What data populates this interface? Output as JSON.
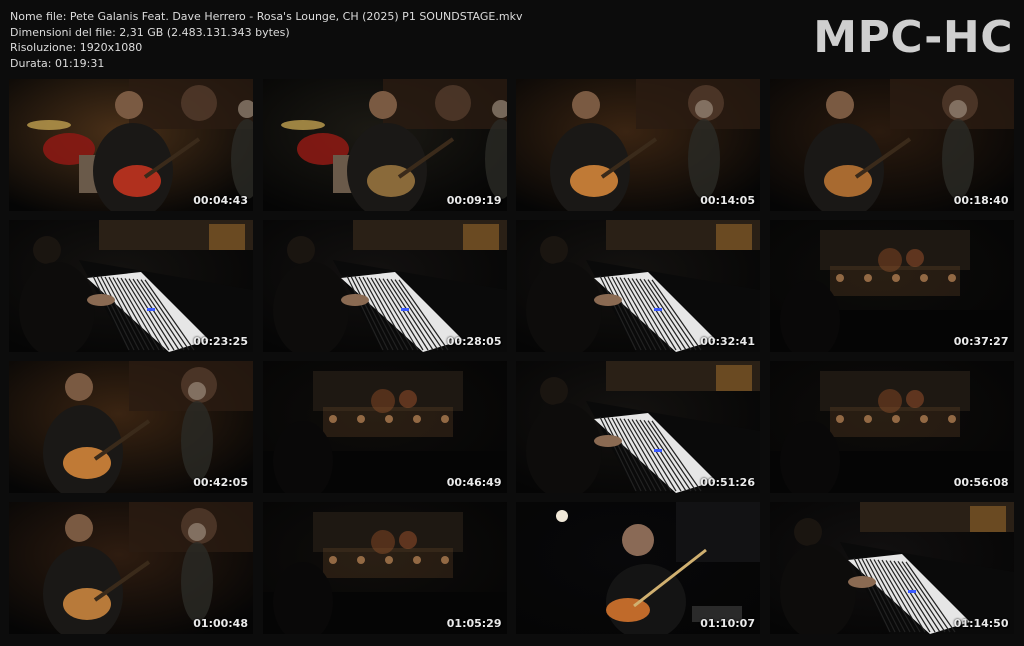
{
  "info": {
    "file_name": "Nome file: Pete Galanis Feat. Dave Herrero - Rosa's Lounge, CH (2025) P1 SOUNDSTAGE.mkv",
    "file_size": "Dimensioni del file: 2,31 GB (2.483.131.343 bytes)",
    "resolution": "Risoluzione: 1920x1080",
    "duration": "Durata: 01:19:31"
  },
  "logo": "MPC-HC",
  "thumbnails": [
    {
      "time": "00:04:43",
      "scene": "band-stage",
      "bg": "#4a3018",
      "accent": "#b0301e"
    },
    {
      "time": "00:09:19",
      "scene": "band-dark",
      "bg": "#1c1a14",
      "accent": "#8a6a3a"
    },
    {
      "time": "00:14:05",
      "scene": "guitarist",
      "bg": "#3a2412",
      "accent": "#c07a36"
    },
    {
      "time": "00:18:40",
      "scene": "guitarist",
      "bg": "#2a1a0e",
      "accent": "#a86a30"
    },
    {
      "time": "00:23:25",
      "scene": "piano",
      "bg": "#141210",
      "accent": "#6a4a22"
    },
    {
      "time": "00:28:05",
      "scene": "piano",
      "bg": "#131110",
      "accent": "#6a4a22"
    },
    {
      "time": "00:32:41",
      "scene": "piano",
      "bg": "#141210",
      "accent": "#6a4a22"
    },
    {
      "time": "00:37:27",
      "scene": "wide-dark",
      "bg": "#0d0c0a",
      "accent": "#7a5530"
    },
    {
      "time": "00:42:05",
      "scene": "guitarist",
      "bg": "#3a2412",
      "accent": "#c07a36"
    },
    {
      "time": "00:46:49",
      "scene": "wide-dark",
      "bg": "#0e0c0a",
      "accent": "#7a5530"
    },
    {
      "time": "00:51:26",
      "scene": "piano",
      "bg": "#141210",
      "accent": "#6a4a22"
    },
    {
      "time": "00:56:08",
      "scene": "wide-dark",
      "bg": "#0e0c0a",
      "accent": "#7a5530"
    },
    {
      "time": "01:00:48",
      "scene": "guitarist",
      "bg": "#2e1c10",
      "accent": "#b87a3a"
    },
    {
      "time": "01:05:29",
      "scene": "wide-dark",
      "bg": "#0f0d0b",
      "accent": "#7a5530"
    },
    {
      "time": "01:10:07",
      "scene": "spotlight",
      "bg": "#08080a",
      "accent": "#c06a2a"
    },
    {
      "time": "01:14:50",
      "scene": "piano",
      "bg": "#121010",
      "accent": "#6a4a22"
    }
  ]
}
